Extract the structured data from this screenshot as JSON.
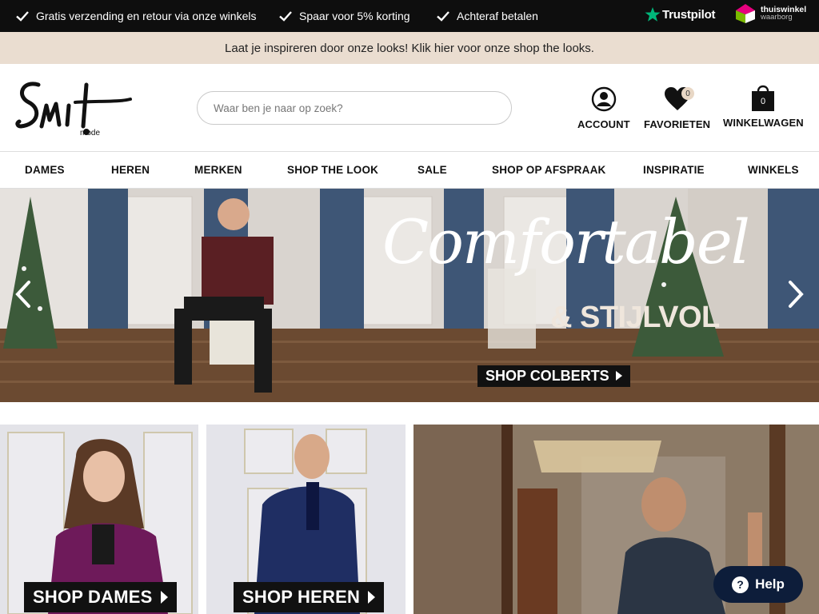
{
  "usp_bar": {
    "items": [
      {
        "label": "Gratis verzending en retour via onze winkels"
      },
      {
        "label": "Spaar voor 5% korting"
      },
      {
        "label": "Achteraf betalen"
      }
    ],
    "trustpilot": "Trustpilot",
    "thuiswinkel": {
      "title": "thuiswinkel",
      "subtitle": "waarborg"
    }
  },
  "promo": {
    "text": "Laat je inspireren door onze looks! Klik hier voor onze shop the looks."
  },
  "header": {
    "logo_text": "Smit",
    "logo_sub": "mode",
    "search_placeholder": "Waar ben je naar op zoek?",
    "account_label": "ACCOUNT",
    "favorites_label": "FAVORIETEN",
    "favorites_count": "0",
    "cart_label": "WINKELWAGEN",
    "cart_count": "0"
  },
  "nav": {
    "items": [
      {
        "label": "DAMES"
      },
      {
        "label": "HEREN"
      },
      {
        "label": "MERKEN"
      },
      {
        "label": "SHOP THE LOOK"
      },
      {
        "label": "SALE"
      },
      {
        "label": "SHOP OP AFSPRAAK"
      },
      {
        "label": "INSPIRATIE"
      },
      {
        "label": "WINKELS"
      }
    ]
  },
  "hero": {
    "script_text": "Comfortabel",
    "sub_text": "& STIJLVOL",
    "cta_label": "SHOP COLBERTS"
  },
  "tiles": [
    {
      "cta_label": "SHOP DAMES"
    },
    {
      "cta_label": "SHOP HEREN"
    }
  ],
  "help": {
    "label": "Help",
    "icon": "?"
  },
  "colors": {
    "top_bar": "#0e0e0e",
    "promo_bg": "#eaddd0",
    "help_bg": "#0d1d3a",
    "trustpilot_green": "#00b67a"
  }
}
